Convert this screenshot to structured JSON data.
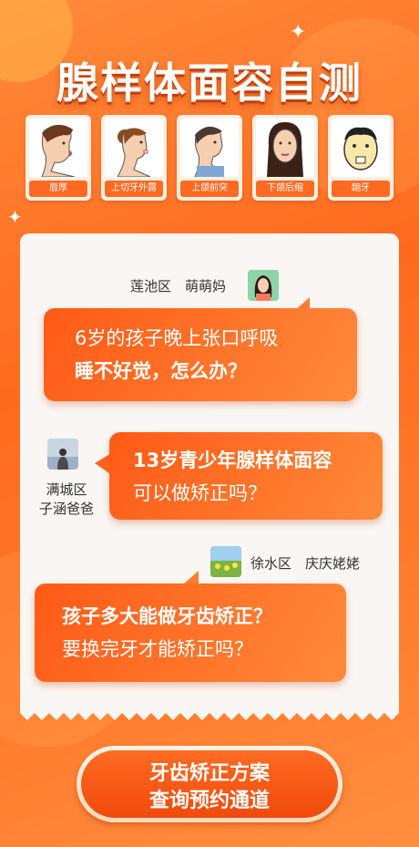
{
  "title": "腺样体面容自测",
  "symptoms": [
    {
      "label": "唇厚",
      "icon": "boy-profile-icon"
    },
    {
      "label": "上切牙外露",
      "icon": "woman-profile-icon"
    },
    {
      "label": "上颌前突",
      "icon": "child-profile-icon"
    },
    {
      "label": "下颌后缩",
      "icon": "woman-front-face-icon"
    },
    {
      "label": "龅牙",
      "icon": "man-buck-teeth-icon"
    }
  ],
  "messages": [
    {
      "user": "莲池区　萌萌妈",
      "line1": "6岁的孩子晚上张口呼吸",
      "line2": "睡不好觉，怎么办？"
    },
    {
      "user_line1": "满城区",
      "user_line2": "子涵爸爸",
      "line1": "13岁青少年腺样体面容",
      "line2": "可以做矫正吗？"
    },
    {
      "user": "徐水区　庆庆姥姥",
      "line1": "孩子多大能做牙齿矫正？",
      "line2": "要换完牙才能矫正吗？"
    }
  ],
  "cta": {
    "line1": "牙齿矫正方案",
    "line2": "查询预约通道"
  },
  "colors": {
    "accent": "#ff6a1e",
    "panel": "#f9f6f3"
  }
}
